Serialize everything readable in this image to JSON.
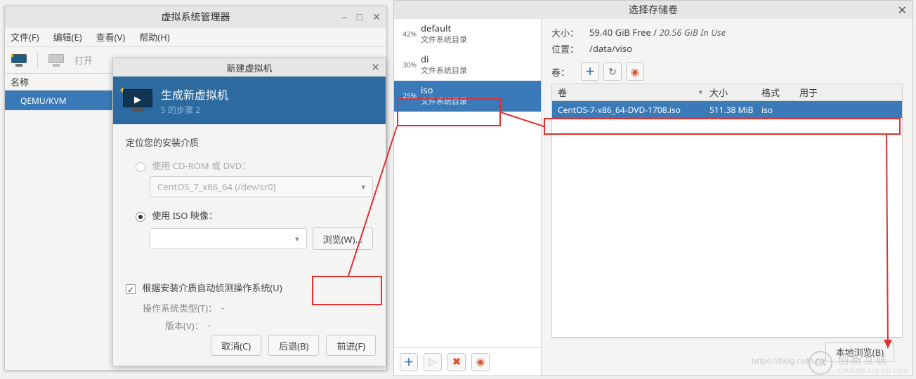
{
  "vmm": {
    "title": "虚拟系统管理器",
    "menus": {
      "file": "文件(F)",
      "edit": "编辑(E)",
      "view": "查看(V)",
      "help": "帮助(H)"
    },
    "open": "打开",
    "col_name": "名称",
    "row": "QEMU/KVM"
  },
  "newvm": {
    "title": "新建虚拟机",
    "head_title": "生成新虚拟机",
    "head_sub": "5 的步骤 2",
    "locate": "定位您的安装介质",
    "radio_cd": "使用 CD-ROM 或 DVD：",
    "cd_value": "CentOS_7_x86_64 (/dev/sr0)",
    "radio_iso": "使用 ISO 映像：",
    "browse": "浏览(W)...",
    "autocheck": "根据安装介质自动侦测操作系统(U)",
    "os_type": "操作系统类型(T)：",
    "os_type_val": "-",
    "version": "版本(V)：",
    "version_val": "-",
    "cancel": "取消(C)",
    "back": "后退(B)",
    "forward": "前进(F)"
  },
  "storage": {
    "title": "选择存储卷",
    "pools": [
      {
        "pct": "42%",
        "name": "default",
        "sub": "文件系统目录"
      },
      {
        "pct": "30%",
        "name": "di",
        "sub": "文件系统目录"
      },
      {
        "pct": "25%",
        "name": "iso",
        "sub": "文件系统目录"
      }
    ],
    "size_label": "大小：",
    "size_free": "59.40 GiB Free",
    "size_use": "20.56 GiB In Use",
    "loc_label": "位置：",
    "loc_val": "/data/viso",
    "vol_label": "卷：",
    "cols": {
      "name": "卷",
      "size": "大小",
      "fmt": "格式",
      "used": "用于"
    },
    "rows": [
      {
        "name": "CentOS-7-x86_64-DVD-1708.iso",
        "size": "511.38 MiB",
        "fmt": "iso",
        "used": ""
      }
    ],
    "local_browse": "本地浏览(B)"
  },
  "watermark": {
    "blog": "https://blog.csdn.ne",
    "circle": "CX",
    "name": "创新互联",
    "sub": "CHUANG XIN HU LIAN"
  }
}
